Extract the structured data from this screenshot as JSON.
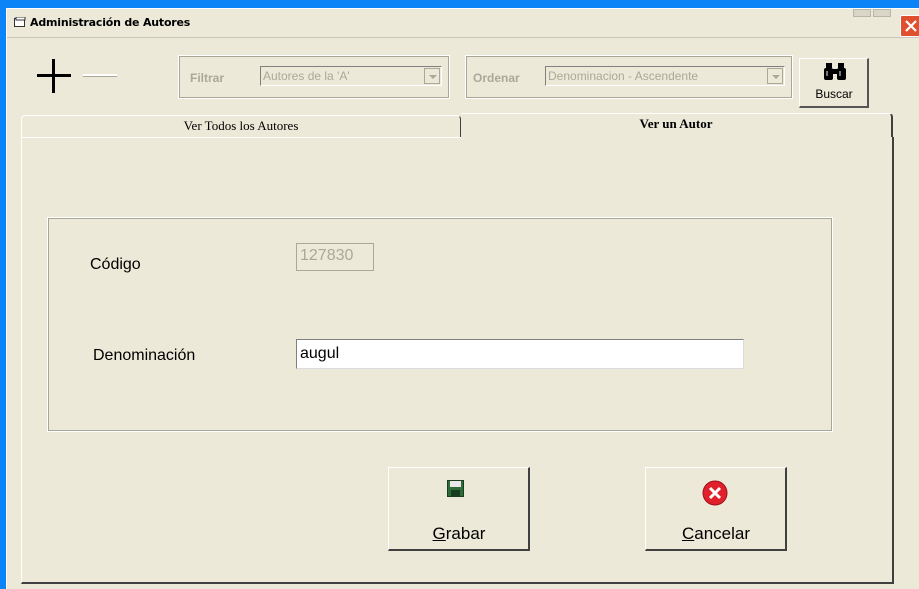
{
  "window": {
    "title": "Administración de Autores"
  },
  "toolbar": {
    "add_icon": "plus-icon",
    "remove_icon": "minus-icon",
    "filter": {
      "label": "Filtrar",
      "value": "Autores de la  'A'"
    },
    "order": {
      "label": "Ordenar",
      "value": "Denominacion - Ascendente"
    },
    "search": {
      "label": "Buscar",
      "icon": "binoculars-icon"
    }
  },
  "tabs": [
    {
      "label": "Ver Todos los Autores",
      "active": false
    },
    {
      "label": "Ver un Autor",
      "active": true
    }
  ],
  "form": {
    "code_label": "Código",
    "code_value": "127830",
    "name_label": "Denominación",
    "name_value": "augul"
  },
  "buttons": {
    "save": {
      "mnemonic": "G",
      "rest": "rabar",
      "icon": "floppy-disk-icon"
    },
    "cancel": {
      "mnemonic": "C",
      "rest": "ancelar",
      "icon": "cancel-circle-icon"
    }
  },
  "colors": {
    "desktop": "#0a84f6",
    "window_bg": "#ece9d8",
    "disabled_text": "#aca899",
    "close_button": "#e0502e",
    "cancel_icon": "#e0202a",
    "save_icon": "#2f6b36"
  }
}
